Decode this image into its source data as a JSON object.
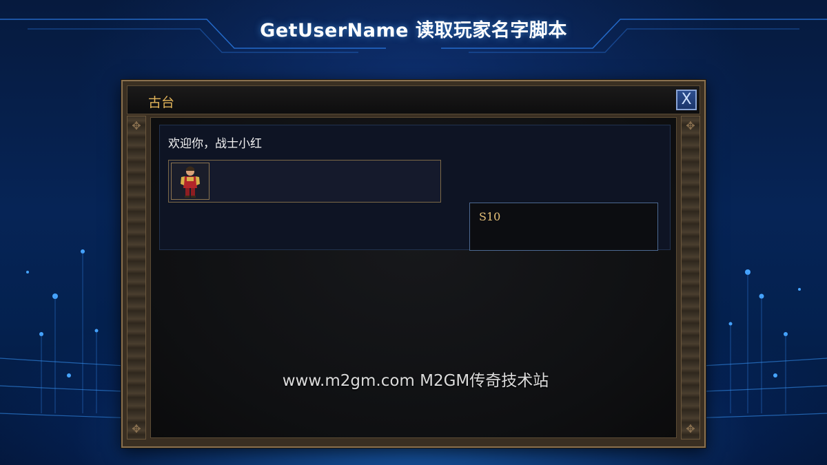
{
  "header": {
    "title": "GetUserName 读取玩家名字脚本"
  },
  "dialog": {
    "title": "古台",
    "close_label": "X",
    "welcome_text": "欢迎你，战士小红",
    "server_label": "S10"
  },
  "watermark": {
    "text": "www.m2gm.com M2GM传奇技术站"
  },
  "colors": {
    "title_gold": "#e2b45a",
    "server_text": "#e8c27a",
    "accent_blue": "#2c4d8e",
    "background_blue": "#062456"
  }
}
